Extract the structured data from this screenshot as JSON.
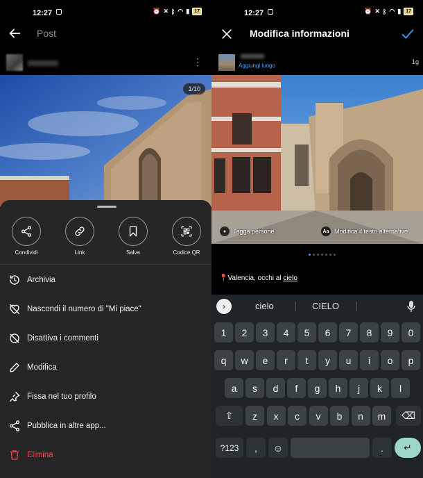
{
  "status": {
    "time": "12:27",
    "battery": "17"
  },
  "left": {
    "title": "Post",
    "counter": "1/10",
    "actions": [
      {
        "label": "Condividi",
        "icon": "share-icon"
      },
      {
        "label": "Link",
        "icon": "link-icon"
      },
      {
        "label": "Salva",
        "icon": "bookmark-icon"
      },
      {
        "label": "Codice QR",
        "icon": "qr-code-icon"
      }
    ],
    "menu": [
      {
        "label": "Archivia",
        "icon": "archive-icon"
      },
      {
        "label": "Nascondi il numero di \"Mi piace\"",
        "icon": "heart-off-icon"
      },
      {
        "label": "Disattiva i commenti",
        "icon": "comment-off-icon"
      },
      {
        "label": "Modifica",
        "icon": "pencil-icon"
      },
      {
        "label": "Fissa nel tuo profilo",
        "icon": "pin-icon"
      },
      {
        "label": "Pubblica in altre app...",
        "icon": "share-icon"
      },
      {
        "label": "Elimina",
        "icon": "trash-icon",
        "color": "#ed4956"
      }
    ]
  },
  "right": {
    "title": "Modifica informazioni",
    "add_location": "Aggiungi luogo",
    "age": "1g",
    "tag_people": "Tagga persone",
    "alt_text": "Modifica il testo alternativo",
    "alt_badge": "Aa",
    "caption_pre": "Valencia,  occhi al ",
    "caption_link": "cielo",
    "accent": "#3897f0",
    "keyboard": {
      "suggestions": [
        "cielo",
        "CIELO"
      ],
      "row1": [
        "1",
        "2",
        "3",
        "4",
        "5",
        "6",
        "7",
        "8",
        "9",
        "0"
      ],
      "row2": [
        "q",
        "w",
        "e",
        "r",
        "t",
        "y",
        "u",
        "i",
        "o",
        "p"
      ],
      "row3": [
        "a",
        "s",
        "d",
        "f",
        "g",
        "h",
        "j",
        "k",
        "l"
      ],
      "row4": [
        "z",
        "x",
        "c",
        "v",
        "b",
        "n",
        "m"
      ],
      "symbols": "?123",
      "comma": ",",
      "period": "."
    }
  }
}
